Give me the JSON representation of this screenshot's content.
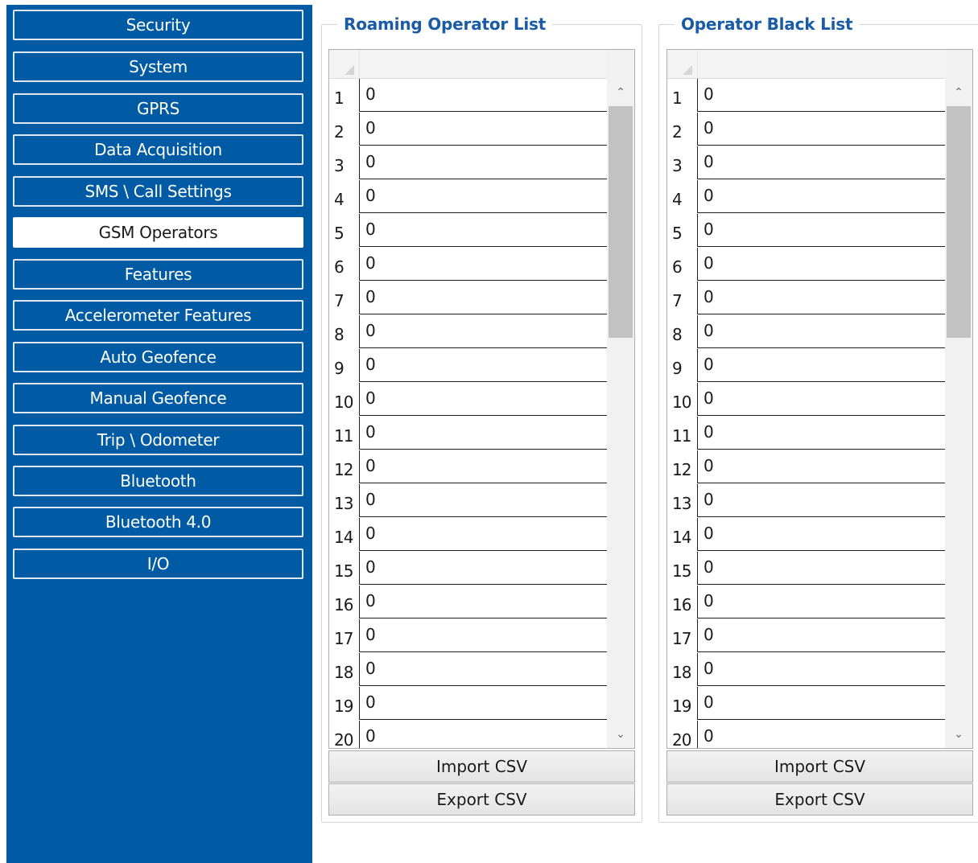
{
  "sidebar": {
    "items": [
      {
        "label": "Security"
      },
      {
        "label": "System"
      },
      {
        "label": "GPRS"
      },
      {
        "label": "Data Acquisition"
      },
      {
        "label": "SMS \\ Call Settings"
      },
      {
        "label": "GSM Operators",
        "active": true
      },
      {
        "label": "Features"
      },
      {
        "label": "Accelerometer Features"
      },
      {
        "label": "Auto Geofence"
      },
      {
        "label": "Manual Geofence"
      },
      {
        "label": "Trip \\ Odometer"
      },
      {
        "label": "Bluetooth"
      },
      {
        "label": "Bluetooth 4.0"
      },
      {
        "label": "I/O"
      }
    ]
  },
  "roaming": {
    "title": "Roaming Operator List",
    "rows": [
      {
        "num": "1",
        "value": "0"
      },
      {
        "num": "2",
        "value": "0"
      },
      {
        "num": "3",
        "value": "0"
      },
      {
        "num": "4",
        "value": "0"
      },
      {
        "num": "5",
        "value": "0"
      },
      {
        "num": "6",
        "value": "0"
      },
      {
        "num": "7",
        "value": "0"
      },
      {
        "num": "8",
        "value": "0"
      },
      {
        "num": "9",
        "value": "0"
      },
      {
        "num": "10",
        "value": "0"
      },
      {
        "num": "11",
        "value": "0"
      },
      {
        "num": "12",
        "value": "0"
      },
      {
        "num": "13",
        "value": "0"
      },
      {
        "num": "14",
        "value": "0"
      },
      {
        "num": "15",
        "value": "0"
      },
      {
        "num": "16",
        "value": "0"
      },
      {
        "num": "17",
        "value": "0"
      },
      {
        "num": "18",
        "value": "0"
      },
      {
        "num": "19",
        "value": "0"
      },
      {
        "num": "20",
        "value": "0"
      }
    ],
    "import_label": "Import CSV",
    "export_label": "Export CSV"
  },
  "blacklist": {
    "title": "Operator Black List",
    "rows": [
      {
        "num": "1",
        "value": "0"
      },
      {
        "num": "2",
        "value": "0"
      },
      {
        "num": "3",
        "value": "0"
      },
      {
        "num": "4",
        "value": "0"
      },
      {
        "num": "5",
        "value": "0"
      },
      {
        "num": "6",
        "value": "0"
      },
      {
        "num": "7",
        "value": "0"
      },
      {
        "num": "8",
        "value": "0"
      },
      {
        "num": "9",
        "value": "0"
      },
      {
        "num": "10",
        "value": "0"
      },
      {
        "num": "11",
        "value": "0"
      },
      {
        "num": "12",
        "value": "0"
      },
      {
        "num": "13",
        "value": "0"
      },
      {
        "num": "14",
        "value": "0"
      },
      {
        "num": "15",
        "value": "0"
      },
      {
        "num": "16",
        "value": "0"
      },
      {
        "num": "17",
        "value": "0"
      },
      {
        "num": "18",
        "value": "0"
      },
      {
        "num": "19",
        "value": "0"
      },
      {
        "num": "20",
        "value": "0"
      }
    ],
    "import_label": "Import CSV",
    "export_label": "Export CSV"
  },
  "icons": {
    "scroll_up": "chevron-up-icon",
    "scroll_down": "chevron-down-icon",
    "grid_corner": "select-all-corner-icon"
  },
  "colors": {
    "sidebar_bg": "#005ba4",
    "title_blue": "#1a5ba8"
  }
}
